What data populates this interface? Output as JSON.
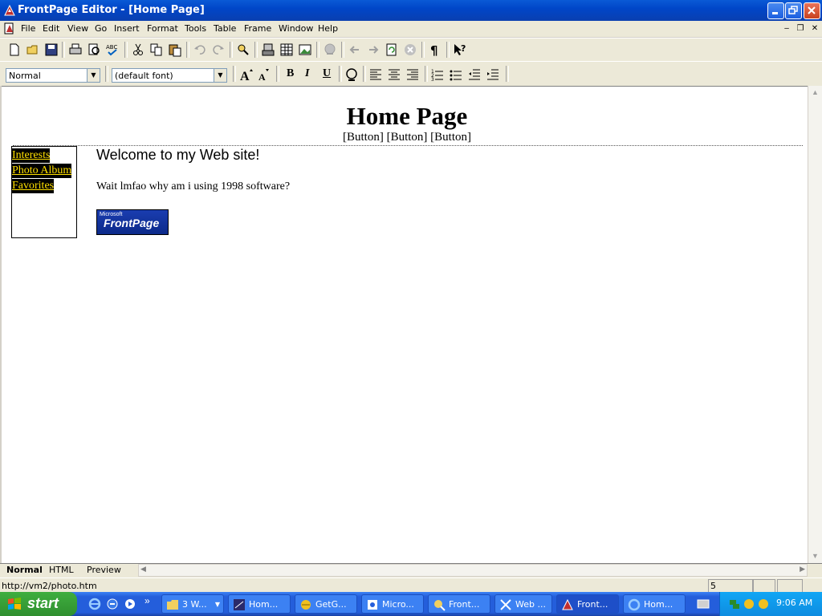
{
  "window": {
    "title": "FrontPage Editor - [Home Page]"
  },
  "menu": [
    "File",
    "Edit",
    "View",
    "Go",
    "Insert",
    "Format",
    "Tools",
    "Table",
    "Frame",
    "Window",
    "Help"
  ],
  "format_toolbar": {
    "style_value": "Normal",
    "font_value": "(default font)",
    "bold": "B",
    "italic": "I",
    "underline": "U"
  },
  "page": {
    "heading": "Home Page",
    "nav_buttons": "[Button] [Button] [Button]",
    "left_nav": [
      "Interests",
      "Photo Album",
      "Favorites"
    ],
    "welcome": "Welcome to my Web site!",
    "body_text": "Wait lmfao why am i using 1998 software?",
    "logo": {
      "small": "Microsoft",
      "main": "FrontPage"
    }
  },
  "view_tabs": [
    "Normal",
    "HTML",
    "Preview"
  ],
  "status": {
    "url": "http://vm2/photo.htm",
    "download_time": "5 seconds"
  },
  "taskbar": {
    "start_label": "start",
    "items": [
      {
        "label": "3 W...",
        "icon": "folder-icon"
      },
      {
        "label": "Hom...",
        "icon": "netscape-icon"
      },
      {
        "label": "GetG...",
        "icon": "browser-icon"
      },
      {
        "label": "Micro...",
        "icon": "app-icon"
      },
      {
        "label": "Front...",
        "icon": "frontpage-explorer-icon"
      },
      {
        "label": "Web ...",
        "icon": "web-icon"
      },
      {
        "label": "Front...",
        "icon": "frontpage-editor-icon"
      },
      {
        "label": "Hom...",
        "icon": "ie-icon"
      }
    ],
    "clock": "9:06 AM"
  },
  "colors": {
    "titlebar": "#0a5ad6",
    "nav_link_text": "#ffe000",
    "nav_link_bg": "#000000",
    "taskbar": "#245edb",
    "start": "#3fae3f"
  }
}
